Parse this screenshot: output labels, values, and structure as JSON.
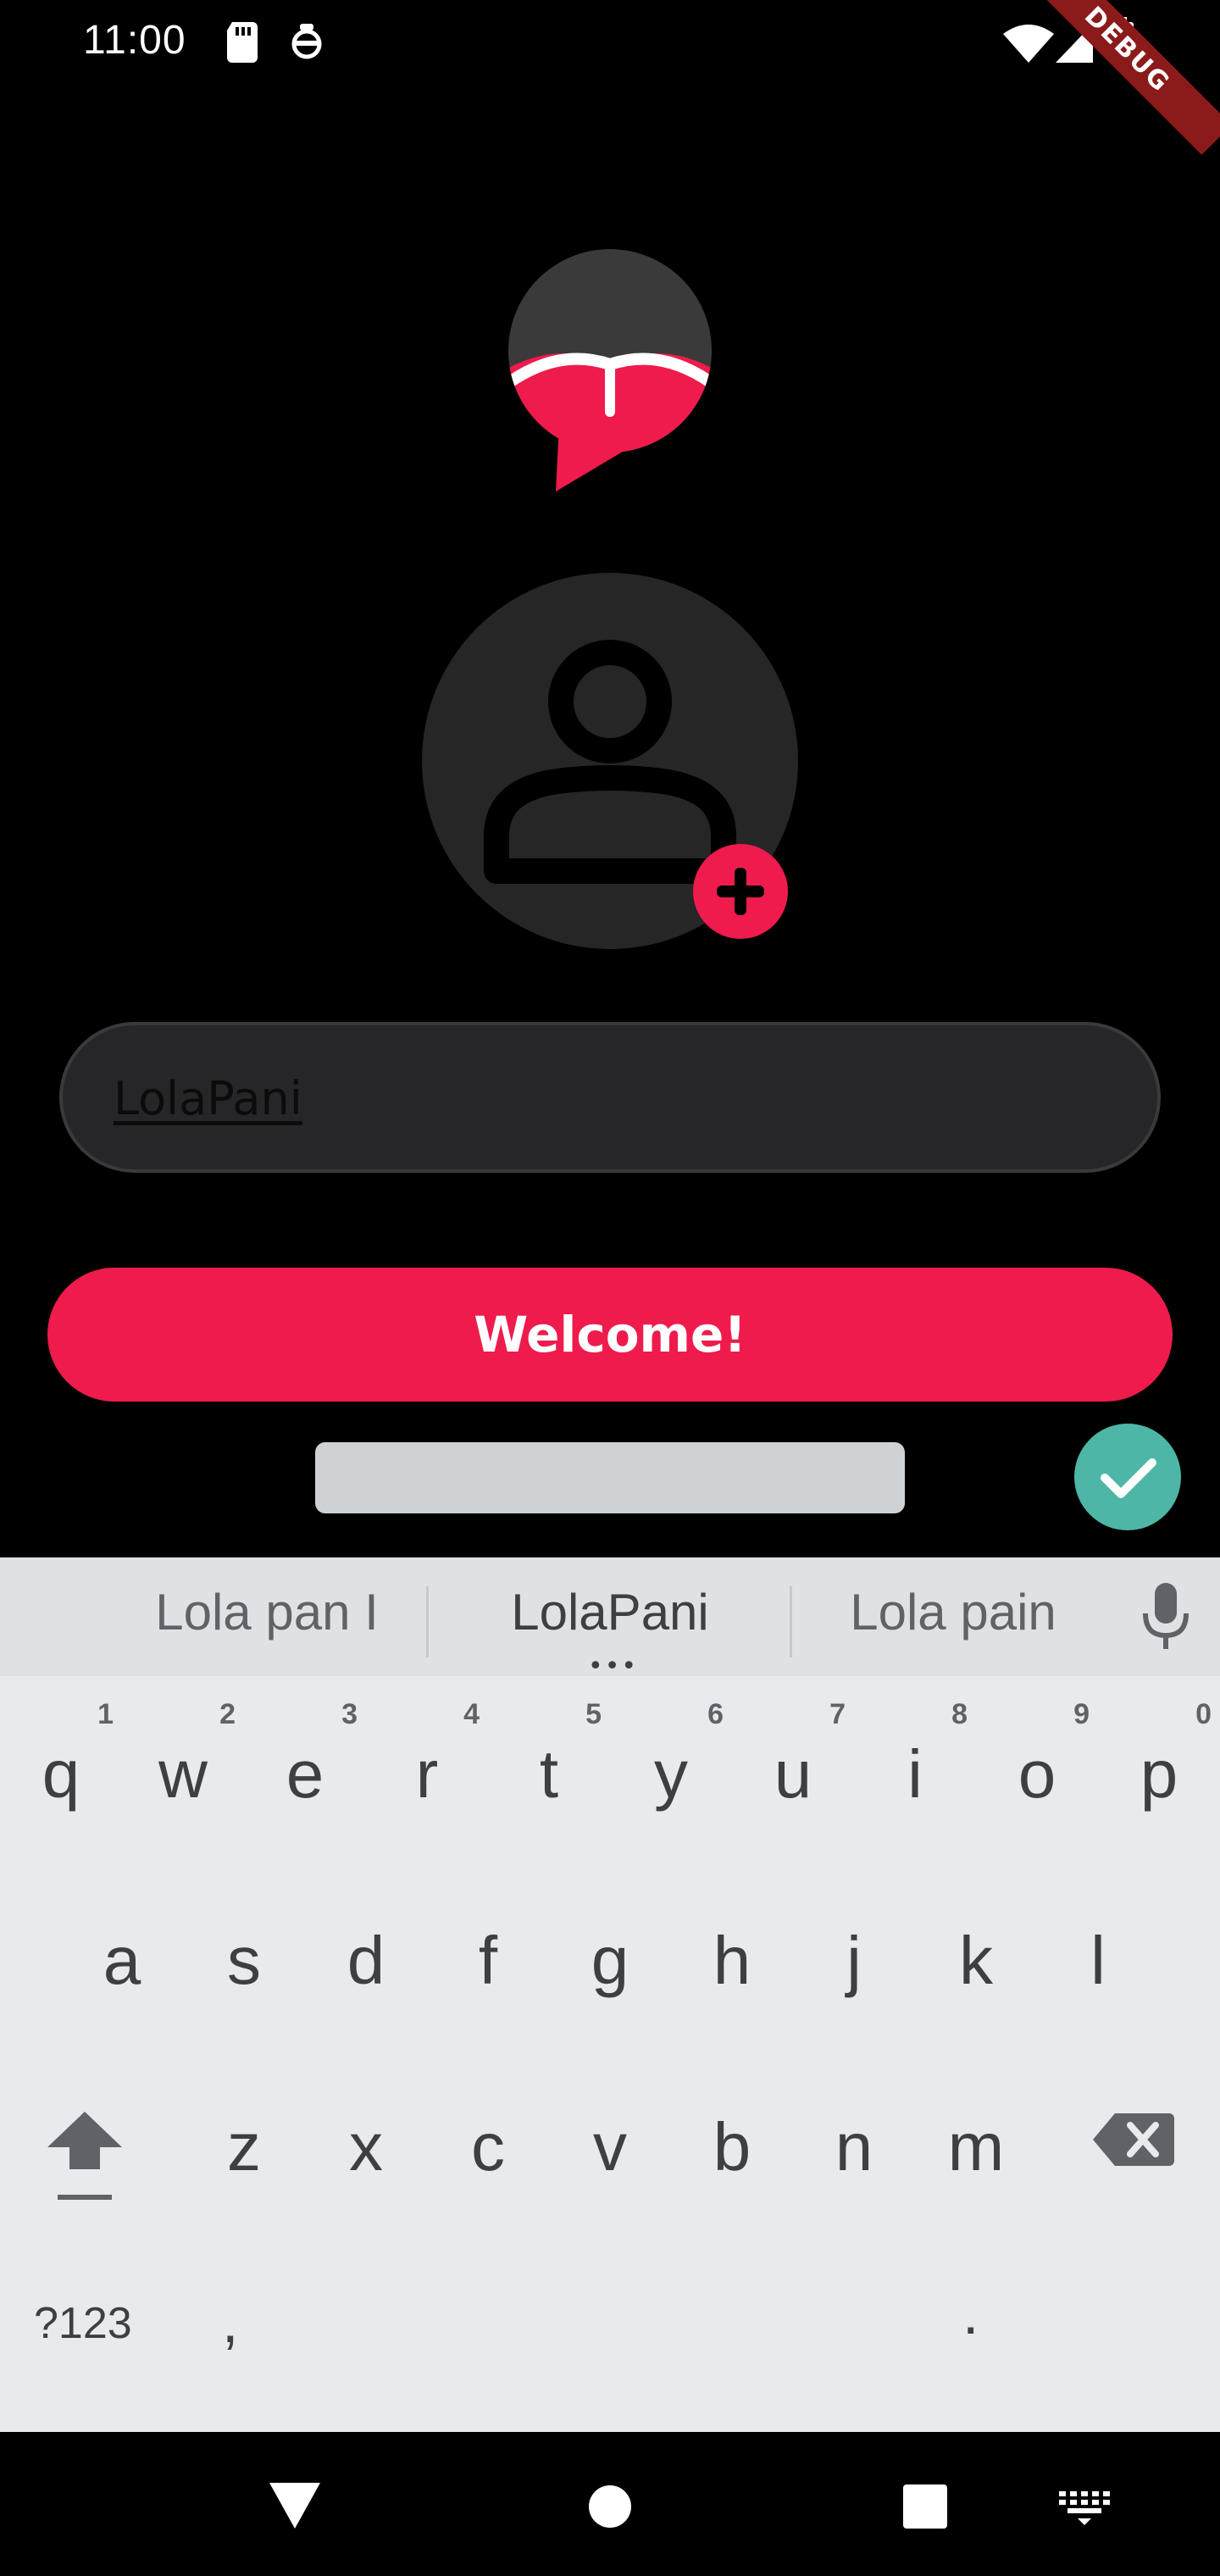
{
  "status_bar": {
    "time": "11:00",
    "debug_label": "DEBUG",
    "icons": [
      "sd-card-icon",
      "vpn-icon",
      "wifi-icon",
      "signal-icon",
      "battery-icon"
    ]
  },
  "app": {
    "logo_icon": "lips-chat-logo-icon",
    "avatar_icon": "person-outline-icon",
    "add_photo_icon": "plus-circle-icon",
    "name_field": {
      "value": "LolaPani"
    },
    "welcome_label": "Welcome!",
    "accent_color": "#ef1b4c"
  },
  "keyboard": {
    "suggestions": [
      "Lola pan I",
      "LolaPani",
      "Lola pain"
    ],
    "suggest_more": "•••",
    "row1": [
      {
        "ch": "q",
        "num": "1"
      },
      {
        "ch": "w",
        "num": "2"
      },
      {
        "ch": "e",
        "num": "3"
      },
      {
        "ch": "r",
        "num": "4"
      },
      {
        "ch": "t",
        "num": "5"
      },
      {
        "ch": "y",
        "num": "6"
      },
      {
        "ch": "u",
        "num": "7"
      },
      {
        "ch": "i",
        "num": "8"
      },
      {
        "ch": "o",
        "num": "9"
      },
      {
        "ch": "p",
        "num": "0"
      }
    ],
    "row2": [
      "a",
      "s",
      "d",
      "f",
      "g",
      "h",
      "j",
      "k",
      "l"
    ],
    "row3": [
      "z",
      "x",
      "c",
      "v",
      "b",
      "n",
      "m"
    ],
    "symbols_label": "?123",
    "comma": ",",
    "period": ".",
    "enter_color": "#4db6a6"
  },
  "nav_bar": {
    "icons": [
      "back-triangle-icon",
      "home-circle-icon",
      "recents-square-icon",
      "keyboard-switch-icon"
    ]
  }
}
